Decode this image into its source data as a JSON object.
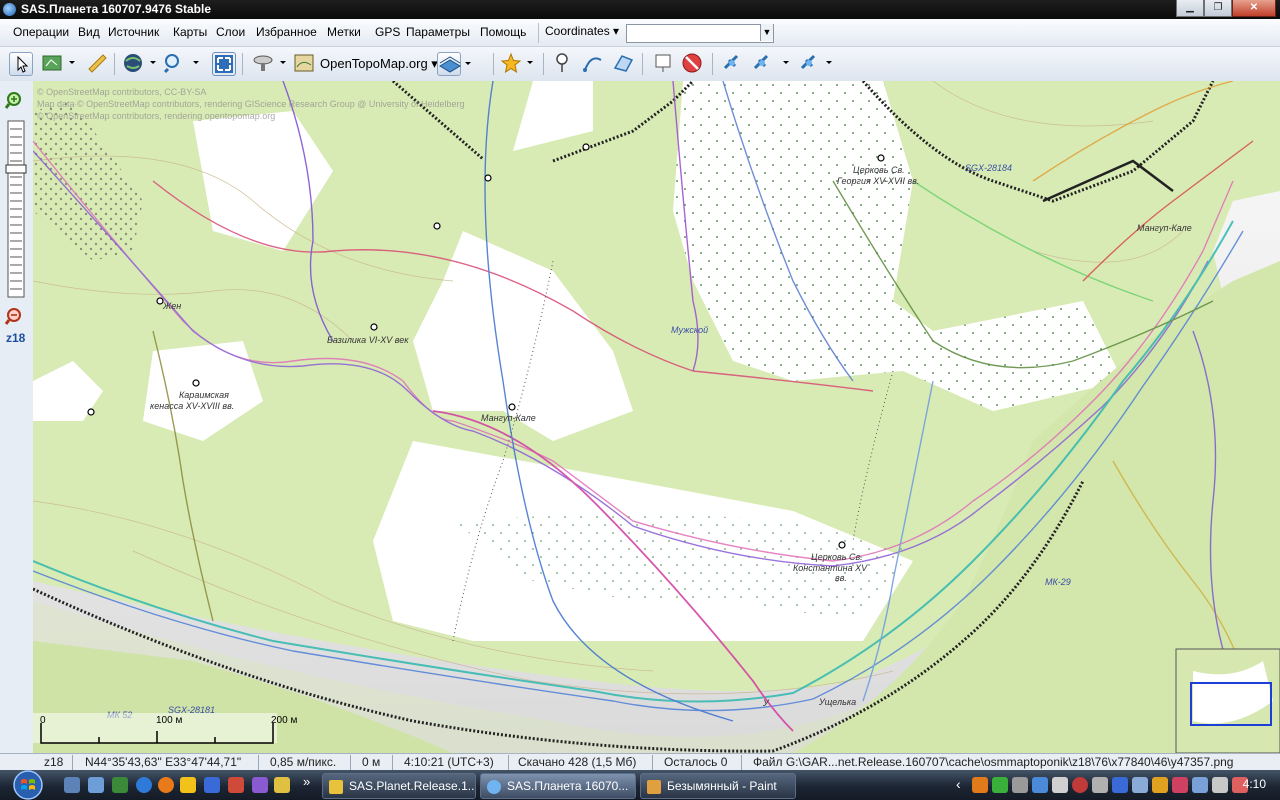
{
  "window": {
    "title": "SAS.Планета 160707.9476 Stable",
    "btn_min": "▁",
    "btn_max": "❐",
    "btn_close": "✕"
  },
  "menu": {
    "items": [
      "Операции",
      "Вид",
      "Источник",
      "Карты",
      "Слои",
      "Избранное",
      "Метки",
      "GPS",
      "Параметры",
      "Помощь"
    ],
    "coordinates_label": "Coordinates ▾",
    "coord_field_value": ""
  },
  "toolbar": {
    "map_source": "OpenTopoMap.org"
  },
  "zoom": {
    "level_label": "z18"
  },
  "map": {
    "attribution": [
      "© OpenStreetMap contributors, CC-BY-SA",
      "Map data © OpenStreetMap contributors, rendering GIScience Research Group @ University of Heidelberg",
      "© OpenStreetMap contributors, rendering opentopomap.org"
    ],
    "labels": {
      "church_george": [
        "Церковь Св.",
        "Георгия XV-XVII вв."
      ],
      "sgx_28184": "SGX-28184",
      "mangup_kale_top": "Мангуп-Кале",
      "male": "Мужской",
      "basilica": "Базилика VI-XV век",
      "mangup_kale": "Мангуп-Кале",
      "karaim": [
        "Караимская",
        "кенасса XV-XVIII вв."
      ],
      "zhen": "Жен",
      "church_konst": [
        "Церковь Св.",
        "Константина XV",
        "вв."
      ],
      "mk29": "МК-29",
      "mk52": "МК 52",
      "sgx_28181": "SGX-28181",
      "usch": "Ущелька",
      "u": "У"
    },
    "scale": {
      "zero": "0",
      "mid": "100 м",
      "end": "200 м"
    }
  },
  "status": {
    "zoom": "z18",
    "coords": "N44°35'43,63\" E33°47'44,71\"",
    "resolution": "0,85 м/пикс.",
    "distance": "0 м",
    "time": "4:10:21 (UTC+3)",
    "downloaded": "Скачано 428 (1,5 Мб)",
    "remaining": "Осталось 0",
    "file": "Файл G:\\GAR...net.Release.160707\\cache\\osmmaptoponik\\z18\\76\\x77840\\46\\y47357.png"
  },
  "taskbar": {
    "tasks": [
      "SAS.Planet.Release.1...",
      "SAS.Планета 16070...",
      "Безымянный - Paint"
    ],
    "clock": "4:10",
    "chevron": "»",
    "tray_left": "‹"
  },
  "colors": {
    "map_green": "#d9ebb5",
    "map_white": "#ffffff",
    "rock": "#c8c8c8",
    "accent": "#2a5ea8"
  }
}
